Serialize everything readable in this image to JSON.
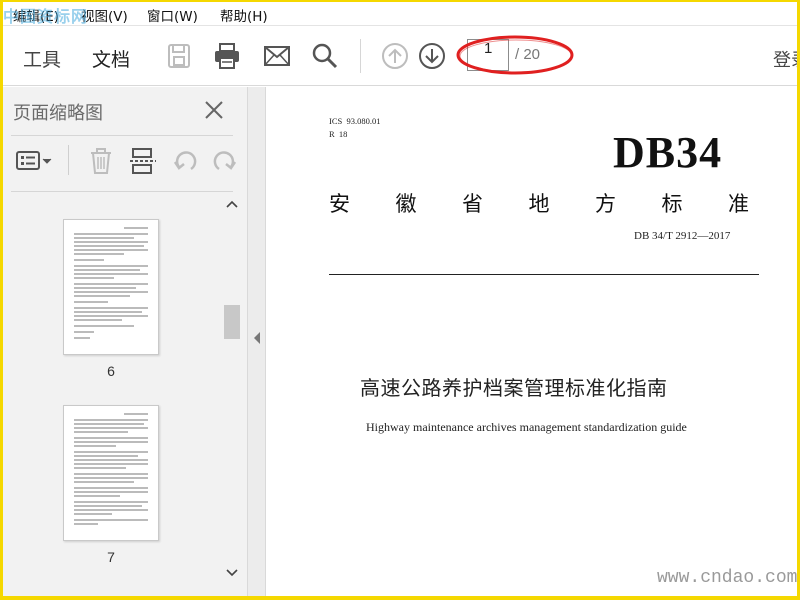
{
  "watermarks": {
    "top": "中国资标网",
    "bottom": "www.cndao.com"
  },
  "menu": {
    "edit": "编辑(E)",
    "view": "视图(V)",
    "window": "窗口(W)",
    "help": "帮助(H)"
  },
  "toolbar": {
    "tab_tools": "工具",
    "tab_document": "文档",
    "page_current": "1",
    "page_total": "/ 20",
    "login": "登录",
    "icons": [
      "save-icon",
      "print-icon",
      "mail-icon",
      "search-icon",
      "page-up-icon",
      "page-down-icon"
    ]
  },
  "sidebar": {
    "title": "页面缩略图",
    "icons": [
      "thumbnail-options-icon",
      "delete-page-icon",
      "extract-page-icon",
      "undo-icon",
      "redo-icon"
    ],
    "thumbnails": [
      {
        "page": "6"
      },
      {
        "page": "7"
      }
    ]
  },
  "document": {
    "ics": "ICS  93.080.01",
    "class_code": "R  18",
    "standard_code": "DB34",
    "province_chars": [
      "安",
      "徽",
      "省",
      "地",
      "方",
      "标",
      "准"
    ],
    "standard_number": "DB 34/T  2912—2017",
    "title_zh": "高速公路养护档案管理标准化指南",
    "title_en": "Highway maintenance archives management standardization guide"
  },
  "colors": {
    "frame": "#f5d800",
    "annotation": "#e02020",
    "panel_bg": "#f2f2f2"
  }
}
